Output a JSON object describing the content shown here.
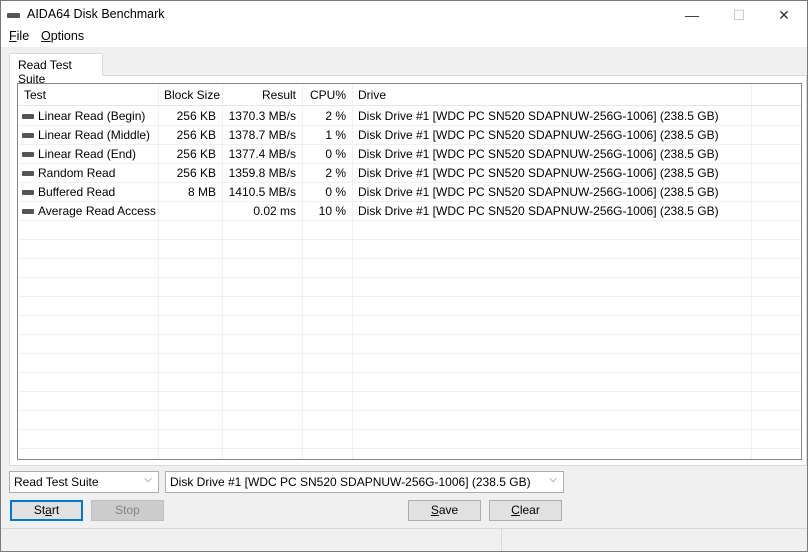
{
  "window": {
    "title": "AIDA64 Disk Benchmark",
    "minimize": "—",
    "maximize": "☐",
    "close": "✕"
  },
  "menu": [
    {
      "label": "File",
      "key": "F",
      "rest": "ile"
    },
    {
      "label": "Options",
      "key": "O",
      "rest": "ptions"
    }
  ],
  "tab": "Read Test Suite",
  "columns": [
    "Test",
    "Block Size",
    "Result",
    "CPU%",
    "Drive"
  ],
  "rows": [
    {
      "test": "Linear Read (Begin)",
      "block": "256 KB",
      "result": "1370.3 MB/s",
      "cpu": "2 %",
      "drive": "Disk Drive #1  [WDC PC SN520 SDAPNUW-256G-1006]  (238.5 GB)"
    },
    {
      "test": "Linear Read (Middle)",
      "block": "256 KB",
      "result": "1378.7 MB/s",
      "cpu": "1 %",
      "drive": "Disk Drive #1  [WDC PC SN520 SDAPNUW-256G-1006]  (238.5 GB)"
    },
    {
      "test": "Linear Read (End)",
      "block": "256 KB",
      "result": "1377.4 MB/s",
      "cpu": "0 %",
      "drive": "Disk Drive #1  [WDC PC SN520 SDAPNUW-256G-1006]  (238.5 GB)"
    },
    {
      "test": "Random Read",
      "block": "256 KB",
      "result": "1359.8 MB/s",
      "cpu": "2 %",
      "drive": "Disk Drive #1  [WDC PC SN520 SDAPNUW-256G-1006]  (238.5 GB)"
    },
    {
      "test": "Buffered Read",
      "block": "8 MB",
      "result": "1410.5 MB/s",
      "cpu": "0 %",
      "drive": "Disk Drive #1  [WDC PC SN520 SDAPNUW-256G-1006]  (238.5 GB)"
    },
    {
      "test": "Average Read Access",
      "block": "",
      "result": "0.02 ms",
      "cpu": "10 %",
      "drive": "Disk Drive #1  [WDC PC SN520 SDAPNUW-256G-1006]  (238.5 GB)"
    }
  ],
  "suite_select": "Read Test Suite",
  "drive_select": "Disk Drive #1  [WDC PC SN520 SDAPNUW-256G-1006]  (238.5 GB)",
  "buttons": {
    "start": {
      "pre": "St",
      "key": "a",
      "post": "rt"
    },
    "stop": "Stop",
    "save": {
      "key": "S",
      "post": "ave"
    },
    "clear": {
      "key": "C",
      "post": "lear"
    }
  }
}
